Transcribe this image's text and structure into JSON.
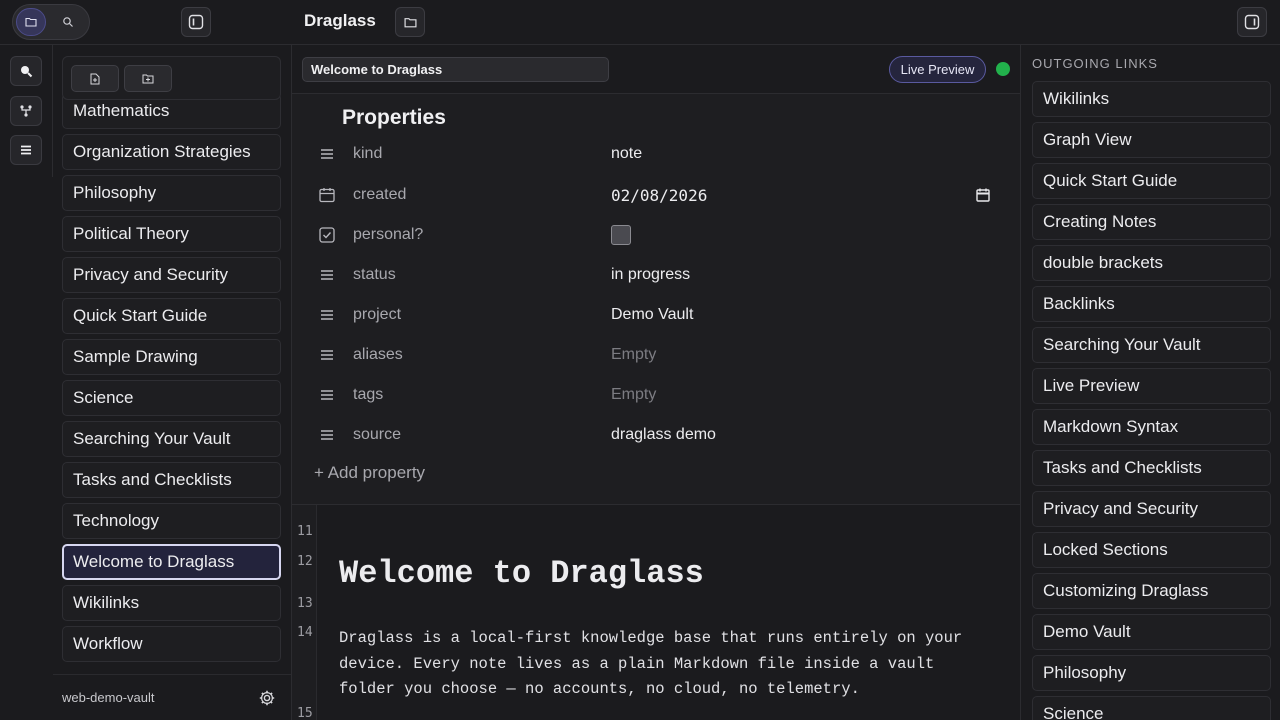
{
  "app": {
    "title": "Draglass"
  },
  "sidebar": {
    "items": [
      {
        "label": "Mathematics"
      },
      {
        "label": "Organization Strategies"
      },
      {
        "label": "Philosophy"
      },
      {
        "label": "Political Theory"
      },
      {
        "label": "Privacy and Security"
      },
      {
        "label": "Quick Start Guide"
      },
      {
        "label": "Sample Drawing"
      },
      {
        "label": "Science"
      },
      {
        "label": "Searching Your Vault"
      },
      {
        "label": "Tasks and Checklists"
      },
      {
        "label": "Technology"
      },
      {
        "label": "Welcome to Draglass",
        "selected": true
      },
      {
        "label": "Wikilinks"
      },
      {
        "label": "Workflow"
      }
    ],
    "vault_name": "web-demo-vault"
  },
  "main": {
    "tab_title": "Welcome to Draglass",
    "mode_label": "Live Preview",
    "properties": {
      "title": "Properties",
      "rows": [
        {
          "icon": "list-icon",
          "key": "kind",
          "value": "note"
        },
        {
          "icon": "calendar-icon",
          "key": "created",
          "value": "02/08/2026"
        },
        {
          "icon": "checkbox-icon",
          "key": "personal?",
          "value": ""
        },
        {
          "icon": "list-icon",
          "key": "status",
          "value": "in progress"
        },
        {
          "icon": "list-icon",
          "key": "project",
          "value": "Demo Vault"
        },
        {
          "icon": "list-icon",
          "key": "aliases",
          "value": "Empty"
        },
        {
          "icon": "list-icon",
          "key": "tags",
          "value": "Empty"
        },
        {
          "icon": "list-icon",
          "key": "source",
          "value": "draglass demo"
        }
      ],
      "add_label": "+ Add property"
    },
    "editor": {
      "line_numbers": [
        "11",
        "12",
        "13",
        "14",
        "15"
      ],
      "heading": "Welcome to Draglass",
      "paragraph_lines": [
        "Draglass is a local-first knowledge base that runs entirely on your",
        "device. Every note lives as a plain Markdown file inside a vault",
        "folder you choose — no accounts, no cloud, no telemetry."
      ]
    }
  },
  "outgoing": {
    "title": "OUTGOING LINKS",
    "items": [
      "Wikilinks",
      "Graph View",
      "Quick Start Guide",
      "Creating Notes",
      "double brackets",
      "Backlinks",
      "Searching Your Vault",
      "Live Preview",
      "Markdown Syntax",
      "Tasks and Checklists",
      "Privacy and Security",
      "Locked Sections",
      "Customizing Draglass",
      "Demo Vault",
      "Philosophy",
      "Science"
    ]
  },
  "colors": {
    "accent": "#5a5aa0",
    "status_ok": "#22b14c",
    "background": "#1b1b1e"
  }
}
